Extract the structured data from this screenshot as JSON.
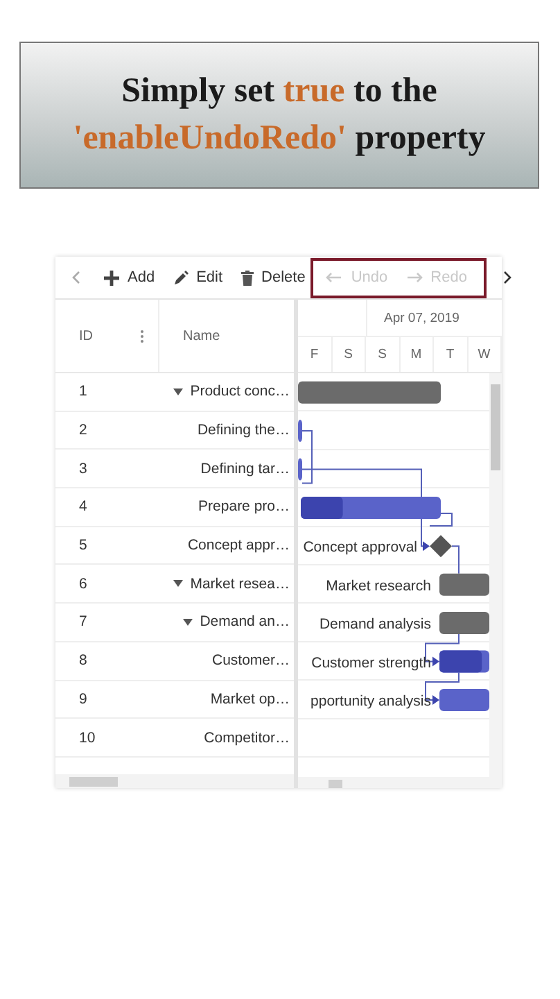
{
  "banner": {
    "lines": [
      [
        {
          "text": "Simply set ",
          "accent": false
        },
        {
          "text": "true",
          "accent": true
        },
        {
          "text": " to the",
          "accent": false
        }
      ],
      [
        {
          "text": "'enableUndoRedo'",
          "accent": true
        },
        {
          "text": " property",
          "accent": false
        }
      ]
    ]
  },
  "toolbar": {
    "items": [
      {
        "kind": "scroll-left"
      },
      {
        "kind": "button",
        "label": "Add",
        "disabled": false
      },
      {
        "kind": "button",
        "label": "Edit",
        "disabled": false
      },
      {
        "kind": "button",
        "label": "Delete",
        "disabled": false
      },
      {
        "kind": "highlight-group",
        "items": [
          {
            "kind": "button",
            "label": "Undo",
            "disabled": true
          },
          {
            "kind": "button",
            "label": "Redo",
            "disabled": true
          }
        ]
      },
      {
        "kind": "scroll-right"
      }
    ]
  },
  "grid": {
    "columns": [
      {
        "label": "ID"
      },
      {
        "label": "Name"
      }
    ]
  },
  "timeline": {
    "month": "Apr 07, 2019",
    "days": [
      "F",
      "S",
      "S",
      "M",
      "T",
      "W"
    ]
  },
  "tasks": [
    {
      "id": "1",
      "name": "Product conc…",
      "expanded": true,
      "bar": {
        "kind": "summary"
      },
      "children": [
        {
          "id": "2",
          "name": "Defining the…",
          "bar": {
            "kind": "task"
          }
        },
        {
          "id": "3",
          "name": "Defining tar…",
          "bar": {
            "kind": "task"
          }
        },
        {
          "id": "4",
          "name": "Prepare pro…",
          "bar": {
            "kind": "task",
            "level": 0.3
          }
        },
        {
          "id": "5",
          "name": "Concept appr…",
          "bar": {
            "kind": "milestone",
            "label": "Concept approval"
          }
        }
      ]
    },
    {
      "id": "6",
      "name": "Market resea…",
      "expanded": true,
      "bar": {
        "kind": "summary",
        "label": "Market research"
      },
      "children": [
        {
          "id": "7",
          "name": "Demand an…",
          "expanded": true,
          "bar": {
            "kind": "summary",
            "label": "Demand analysis"
          },
          "children": [
            {
              "id": "8",
              "name": "Customer…",
              "bar": {
                "kind": "task",
                "level": 0.85,
                "label": "Customer strength"
              }
            },
            {
              "id": "9",
              "name": "Market op…",
              "bar": {
                "kind": "task",
                "label": "pportunity analysis"
              }
            }
          ]
        },
        {
          "id": "10",
          "name": "Competitor…",
          "bar": {
            "kind": "none"
          }
        }
      ]
    }
  ]
}
